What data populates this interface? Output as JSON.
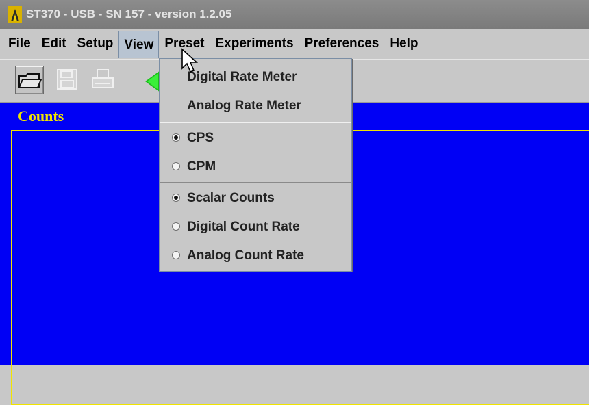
{
  "window": {
    "title": "ST370 - USB - SN 157 - version 1.2.05"
  },
  "menubar": {
    "items": [
      "File",
      "Edit",
      "Setup",
      "View",
      "Preset",
      "Experiments",
      "Preferences",
      "Help"
    ],
    "active": "View"
  },
  "toolbar": {
    "buttons": [
      "open-icon",
      "save-icon",
      "print-icon",
      "start-icon"
    ],
    "accent_green": "#1bbd1b"
  },
  "panel": {
    "title": "Counts",
    "background": "#0000f5",
    "title_color": "#f0e400"
  },
  "view_menu": {
    "meters": [
      "Digital Rate Meter",
      "Analog Rate Meter"
    ],
    "rate_units": [
      {
        "label": "CPS",
        "selected": true
      },
      {
        "label": "CPM",
        "selected": false
      }
    ],
    "displays": [
      {
        "label": "Scalar Counts",
        "selected": true
      },
      {
        "label": "Digital Count Rate",
        "selected": false
      },
      {
        "label": "Analog Count Rate",
        "selected": false
      }
    ]
  }
}
